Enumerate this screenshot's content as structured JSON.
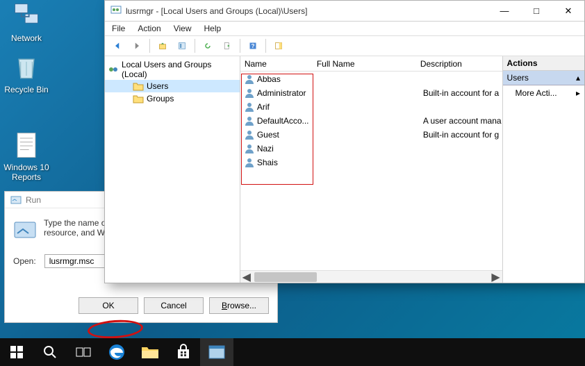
{
  "desktop": {
    "network": "Network",
    "recycle": "Recycle Bin",
    "reports": "Windows 10 Reports"
  },
  "run": {
    "title": "Run",
    "prompt": "Type the name of a program, folder, document, or Internet resource, and Windows will open it for you.",
    "open_label": "Open:",
    "value": "lusrmgr.msc",
    "ok": "OK",
    "cancel": "Cancel",
    "browse": "Browse..."
  },
  "window": {
    "title": "lusrmgr - [Local Users and Groups (Local)\\Users]",
    "menus": [
      "File",
      "Action",
      "View",
      "Help"
    ]
  },
  "tree": {
    "root": "Local Users and Groups (Local)",
    "nodes": [
      "Users",
      "Groups"
    ]
  },
  "list": {
    "headers": {
      "name": "Name",
      "full": "Full Name",
      "desc": "Description"
    },
    "rows": [
      {
        "name": "Abbas",
        "full": "",
        "desc": ""
      },
      {
        "name": "Administrator",
        "full": "",
        "desc": "Built-in account for a"
      },
      {
        "name": "Arif",
        "full": "",
        "desc": ""
      },
      {
        "name": "DefaultAcco...",
        "full": "",
        "desc": "A user account mana"
      },
      {
        "name": "Guest",
        "full": "",
        "desc": "Built-in account for g"
      },
      {
        "name": "Nazi",
        "full": "",
        "desc": ""
      },
      {
        "name": "Shais",
        "full": "",
        "desc": ""
      }
    ]
  },
  "actions": {
    "header": "Actions",
    "group": "Users",
    "more": "More Acti..."
  }
}
